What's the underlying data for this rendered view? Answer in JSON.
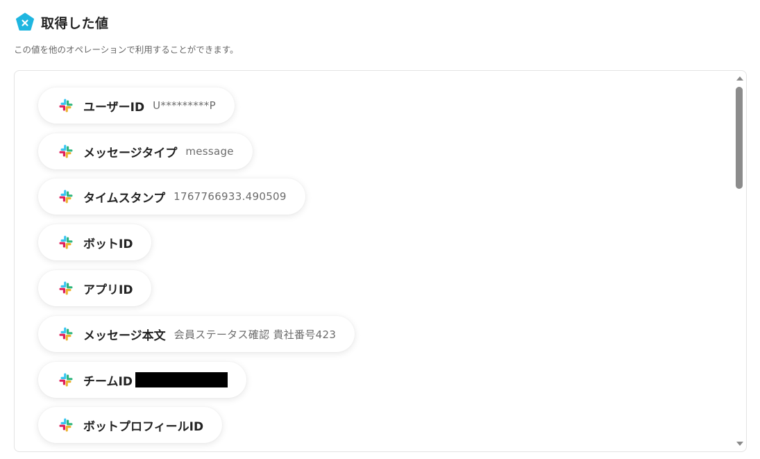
{
  "header": {
    "title": "取得した値",
    "icon": "yoom-x-icon",
    "icon_color": "#1FB6E0"
  },
  "subtitle": "この値を他のオペレーションで利用することができます。",
  "items": [
    {
      "label": "ユーザーID",
      "value": "U*********P",
      "icon": "slack-icon"
    },
    {
      "label": "メッセージタイプ",
      "value": "message",
      "icon": "slack-icon"
    },
    {
      "label": "タイムスタンプ",
      "value": "1767766933.490509",
      "icon": "slack-icon"
    },
    {
      "label": "ボットID",
      "value": "",
      "icon": "slack-icon"
    },
    {
      "label": "アプリID",
      "value": "",
      "icon": "slack-icon"
    },
    {
      "label": "メッセージ本文",
      "value": "会員ステータス確認 貴社番号423",
      "icon": "slack-icon"
    },
    {
      "label": "チームID",
      "value": "",
      "redacted": true,
      "icon": "slack-icon"
    },
    {
      "label": "ボットプロフィールID",
      "value": "",
      "icon": "slack-icon"
    }
  ]
}
